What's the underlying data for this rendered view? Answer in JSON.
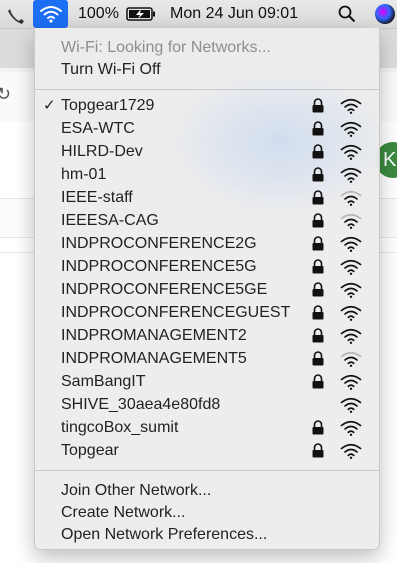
{
  "menubar": {
    "battery_percent": "100%",
    "datetime": "Mon 24 Jun  09:01"
  },
  "background": {
    "avatar_letter": "K"
  },
  "wifi_menu": {
    "status": "Wi-Fi: Looking for Networks...",
    "toggle_label": "Turn Wi-Fi Off",
    "networks": [
      {
        "name": "Topgear1729",
        "connected": true,
        "locked": true,
        "signal": 3
      },
      {
        "name": "ESA-WTC",
        "connected": false,
        "locked": true,
        "signal": 3
      },
      {
        "name": "HILRD-Dev",
        "connected": false,
        "locked": true,
        "signal": 3
      },
      {
        "name": "hm-01",
        "connected": false,
        "locked": true,
        "signal": 3
      },
      {
        "name": "IEEE-staff",
        "connected": false,
        "locked": true,
        "signal": 2
      },
      {
        "name": "IEEESA-CAG",
        "connected": false,
        "locked": true,
        "signal": 2
      },
      {
        "name": "INDPROCONFERENCE2G",
        "connected": false,
        "locked": true,
        "signal": 3
      },
      {
        "name": "INDPROCONFERENCE5G",
        "connected": false,
        "locked": true,
        "signal": 3
      },
      {
        "name": "INDPROCONFERENCE5GE",
        "connected": false,
        "locked": true,
        "signal": 3
      },
      {
        "name": "INDPROCONFERENCEGUEST",
        "connected": false,
        "locked": true,
        "signal": 3
      },
      {
        "name": "INDPROMANAGEMENT2",
        "connected": false,
        "locked": true,
        "signal": 3
      },
      {
        "name": "INDPROMANAGEMENT5",
        "connected": false,
        "locked": true,
        "signal": 2
      },
      {
        "name": "SamBangIT",
        "connected": false,
        "locked": true,
        "signal": 3
      },
      {
        "name": "SHIVE_30aea4e80fd8",
        "connected": false,
        "locked": false,
        "signal": 3
      },
      {
        "name": "tingcoBox_sumit",
        "connected": false,
        "locked": true,
        "signal": 3
      },
      {
        "name": "Topgear",
        "connected": false,
        "locked": true,
        "signal": 3
      }
    ],
    "actions": {
      "join_other": "Join Other Network...",
      "create": "Create Network...",
      "preferences": "Open Network Preferences..."
    }
  },
  "colors": {
    "highlight": "#1c6ef2",
    "menu_bg": "#ececec"
  }
}
